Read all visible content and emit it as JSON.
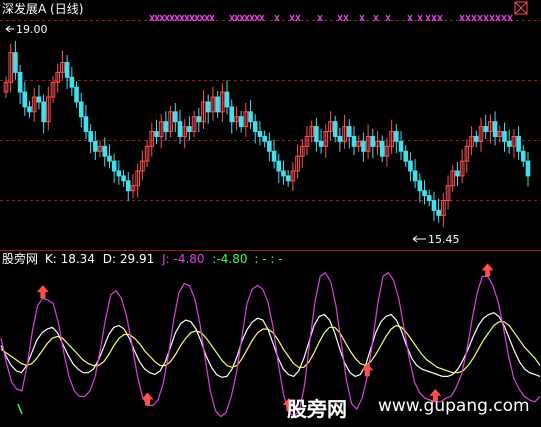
{
  "header": {
    "title": "深发展A",
    "period": "(日线)",
    "title_color": "#ffffff"
  },
  "price_panel": {
    "high_label": "19.00",
    "low_label": "15.45",
    "up_color": "#ff5050",
    "down_color": "#40e0f0",
    "signal_color": "#e040e0"
  },
  "indicator": {
    "name": "股旁网",
    "k_label": "K:",
    "k_value": "18.34",
    "d_label": "D:",
    "d_value": "29.91",
    "j_label": "J:",
    "j_value": "-4.80",
    "extra_value": ":-4.80",
    "extra_tail": ": -  : -",
    "k_color": "#ffffff",
    "d_color": "#ffff60",
    "j_color": "#e040e0",
    "extra_color": "#40ff40",
    "arrow_color": "#ff5050"
  },
  "watermark": {
    "cn": "股旁网",
    "url": "www.gupang.com"
  },
  "chart_data": [
    {
      "type": "candlestick",
      "title": "深发展A (日线)",
      "ylim": [
        15.0,
        19.3
      ],
      "annotations": [
        {
          "text": "19.00",
          "value": 19.0,
          "kind": "high"
        },
        {
          "text": "15.45",
          "value": 15.45,
          "kind": "low"
        }
      ],
      "closes": [
        18.2,
        18.8,
        18.4,
        18.0,
        17.7,
        17.6,
        17.9,
        17.8,
        17.4,
        17.9,
        18.2,
        18.4,
        18.6,
        18.3,
        18.1,
        17.8,
        17.5,
        17.2,
        17.0,
        16.8,
        16.9,
        16.7,
        16.6,
        16.4,
        16.3,
        16.2,
        16.0,
        16.1,
        16.4,
        16.6,
        16.9,
        17.2,
        17.1,
        17.4,
        17.2,
        17.6,
        17.4,
        17.1,
        17.3,
        17.2,
        17.5,
        17.4,
        17.8,
        17.6,
        17.9,
        17.6,
        18.0,
        17.7,
        17.4,
        17.5,
        17.3,
        17.6,
        17.4,
        17.2,
        17.1,
        17.0,
        16.8,
        16.6,
        16.4,
        16.3,
        16.2,
        16.4,
        16.7,
        16.9,
        17.1,
        17.3,
        17.0,
        16.9,
        17.2,
        17.4,
        17.1,
        17.0,
        17.3,
        17.1,
        16.9,
        17.0,
        16.8,
        17.1,
        16.9,
        17.0,
        16.7,
        16.9,
        17.2,
        17.0,
        16.8,
        16.6,
        16.4,
        16.2,
        16.0,
        15.9,
        15.8,
        15.6,
        15.5,
        15.8,
        16.1,
        16.4,
        16.3,
        16.6,
        16.9,
        17.1,
        17.0,
        17.3,
        17.2,
        17.4,
        17.1,
        17.2,
        17.0,
        16.9,
        17.1,
        16.8,
        16.6,
        16.3
      ]
    },
    {
      "type": "line",
      "title": "股旁网",
      "series": [
        {
          "name": "K",
          "values": [
            52,
            40,
            30,
            24,
            22,
            30,
            44,
            58,
            66,
            70,
            72,
            66,
            54,
            42,
            32,
            26,
            22,
            22,
            26,
            36,
            50,
            64,
            72,
            74,
            70,
            60,
            46,
            34,
            26,
            22,
            20,
            24,
            34,
            50,
            66,
            76,
            80,
            78,
            70,
            56,
            40,
            28,
            20,
            17,
            18,
            26,
            40,
            58,
            70,
            78,
            82,
            80,
            70,
            54,
            38,
            26,
            20,
            18,
            24,
            38,
            56,
            74,
            84,
            86,
            80,
            66,
            48,
            32,
            22,
            18,
            20,
            30,
            48,
            66,
            78,
            84,
            86,
            80,
            68,
            52,
            38,
            30,
            26,
            24,
            22,
            20,
            18,
            18,
            20,
            26,
            36,
            48,
            62,
            74,
            82,
            86,
            88,
            84,
            74,
            60,
            46,
            34,
            26,
            22,
            20,
            18
          ]
        },
        {
          "name": "D",
          "values": [
            48,
            44,
            40,
            36,
            32,
            30,
            32,
            38,
            46,
            54,
            60,
            62,
            60,
            54,
            48,
            42,
            36,
            32,
            30,
            30,
            34,
            42,
            52,
            60,
            64,
            64,
            60,
            54,
            46,
            40,
            34,
            30,
            30,
            34,
            42,
            52,
            60,
            66,
            68,
            66,
            60,
            52,
            44,
            36,
            30,
            28,
            30,
            38,
            48,
            58,
            66,
            70,
            70,
            66,
            58,
            48,
            40,
            32,
            28,
            28,
            34,
            44,
            56,
            66,
            72,
            72,
            66,
            56,
            46,
            38,
            32,
            30,
            34,
            42,
            52,
            62,
            70,
            74,
            72,
            66,
            58,
            50,
            42,
            36,
            32,
            28,
            26,
            24,
            22,
            22,
            24,
            30,
            38,
            48,
            58,
            66,
            74,
            78,
            78,
            74,
            66,
            58,
            50,
            44,
            38,
            30
          ]
        },
        {
          "name": "J",
          "values": [
            60,
            34,
            12,
            4,
            2,
            30,
            68,
            96,
            104,
            102,
            98,
            76,
            44,
            18,
            2,
            -4,
            -4,
            2,
            18,
            48,
            82,
            108,
            112,
            104,
            84,
            54,
            20,
            -4,
            -14,
            -14,
            -8,
            10,
            42,
            80,
            110,
            120,
            118,
            104,
            76,
            38,
            2,
            -20,
            -26,
            -22,
            -4,
            22,
            60,
            98,
            114,
            118,
            114,
            100,
            72,
            32,
            -2,
            -22,
            -26,
            -20,
            8,
            56,
            100,
            128,
            132,
            122,
            96,
            56,
            14,
            -12,
            -18,
            -6,
            18,
            56,
            98,
            128,
            132,
            124,
            104,
            72,
            38,
            12,
            0,
            -6,
            -8,
            -10,
            -10,
            -6,
            -4,
            6,
            20,
            46,
            80,
            110,
            128,
            128,
            118,
            100,
            72,
            40,
            16,
            4,
            -4,
            -8,
            -10,
            -4
          ]
        }
      ],
      "signals": [
        8,
        28,
        55,
        70,
        83,
        93
      ]
    }
  ]
}
